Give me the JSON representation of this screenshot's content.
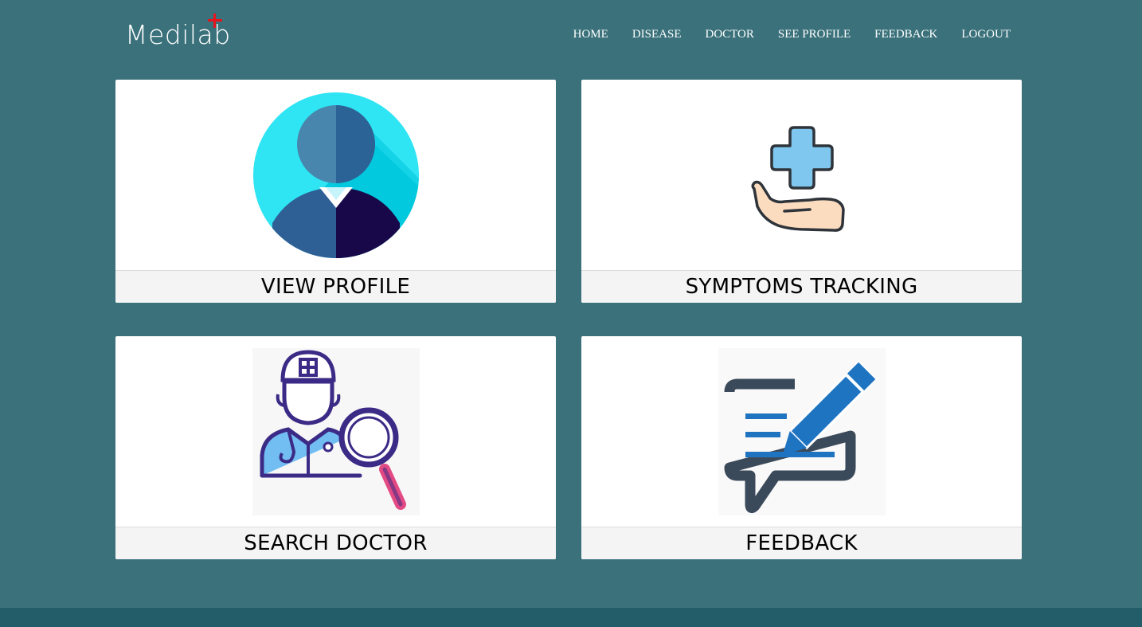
{
  "brand": {
    "logo_text": "Medilab",
    "accent_color": "#e8131b"
  },
  "nav": {
    "items": [
      "HOME",
      "DISEASE",
      "DOCTOR",
      "SEE PROFILE",
      "FEEDBACK",
      "LOGOUT"
    ]
  },
  "cards": [
    {
      "label": "VIEW PROFILE",
      "icon": "user-avatar-icon"
    },
    {
      "label": "SYMPTOMS TRACKING",
      "icon": "medical-care-hand-icon"
    },
    {
      "label": "SEARCH DOCTOR",
      "icon": "doctor-search-icon"
    },
    {
      "label": "FEEDBACK",
      "icon": "feedback-pencil-icon"
    }
  ],
  "colors": {
    "background": "#3a717b",
    "footer": "#235d69",
    "card_label_bg": "#f4f4f4"
  }
}
